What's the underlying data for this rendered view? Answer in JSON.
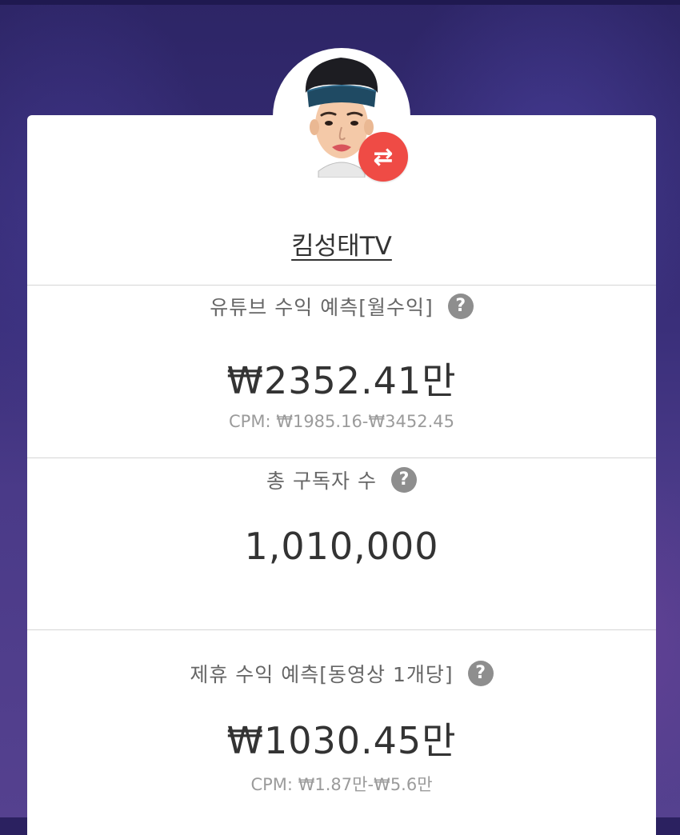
{
  "profile": {
    "channel_name": "킴성태TV",
    "avatar_icon": "cartoon-avatar-icon",
    "swap_icon": "swap-arrows-icon",
    "swap_glyph": "⇄",
    "accent_color": "#ef4b45"
  },
  "youtube_revenue": {
    "title": "유튜브 수익 예측[월수익]",
    "value": "₩2352.41만",
    "cpm": "CPM: ₩1985.16-₩3452.45"
  },
  "subscribers": {
    "title": "총 구독자 수",
    "value": "1,010,000"
  },
  "affiliate_revenue": {
    "title": "제휴 수익 예측[동영상 1개당]",
    "value": "₩1030.45만",
    "cpm": "CPM: ₩1.87만-₩5.6만"
  },
  "help_glyph": "?"
}
